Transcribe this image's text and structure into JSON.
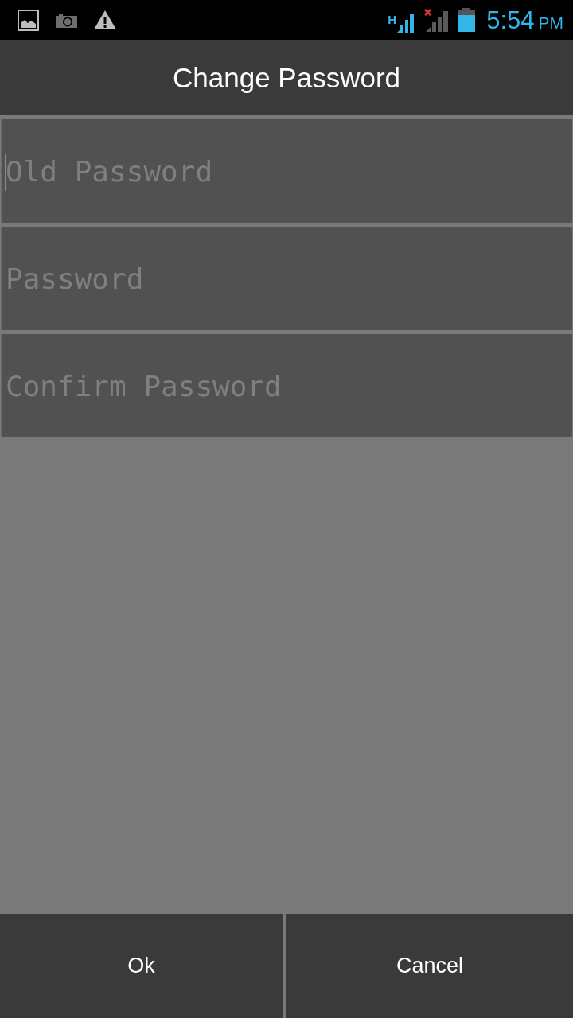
{
  "status_bar": {
    "network_type": "H",
    "time": "5:54",
    "meridiem": "PM"
  },
  "title": "Change Password",
  "fields": [
    {
      "placeholder": "Old Password",
      "focused": true
    },
    {
      "placeholder": "Password",
      "focused": false
    },
    {
      "placeholder": "Confirm Password",
      "focused": false
    }
  ],
  "buttons": [
    "Ok",
    "Cancel"
  ]
}
